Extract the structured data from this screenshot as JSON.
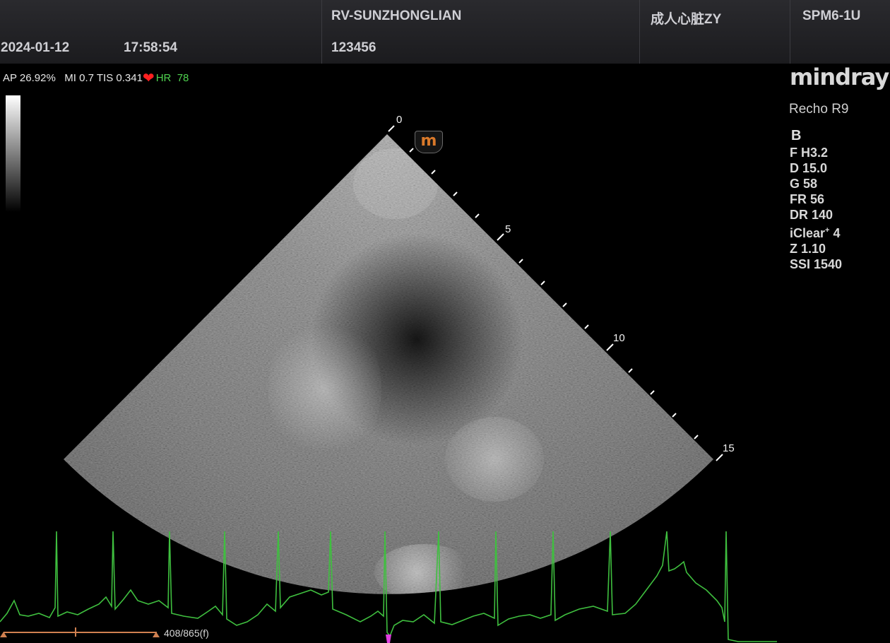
{
  "header": {
    "date": "2024-01-12",
    "time": "17:58:54",
    "patient_name": "RV-SUNZHONGLIAN",
    "patient_id": "123456",
    "exam_preset": "成人心脏ZY",
    "probe": "SPM6-1U"
  },
  "params": {
    "ap": "AP 26.92%",
    "mi_tis": "MI 0.7 TIS 0.341",
    "hr_label": "HR",
    "hr_value": "78"
  },
  "brand": {
    "logo": "mindray",
    "model": "Recho R9"
  },
  "imaging": {
    "mode": "B",
    "freq": "F H3.2",
    "depth": "D 15.0",
    "gain": "G 58",
    "frame_rate": "FR 56",
    "dynamic_range": "DR 140",
    "iclear_label": "iClear",
    "iclear_sup": "+",
    "iclear_value": " 4",
    "zoom": "Z 1.10",
    "ssi": "SSI 1540"
  },
  "depth_scale": {
    "labels": [
      "0",
      "5",
      "10",
      "15"
    ]
  },
  "orientation_marker": "m",
  "cine": {
    "frame_counter": "408/865(f)",
    "progress": 0.4717
  },
  "colors": {
    "ecg": "#3fbf3f",
    "heart": "#ff2020",
    "hr_text": "#4fd24f",
    "marker": "#d9792a",
    "cine_bar": "#d08050",
    "cursor": "#e040e0"
  },
  "icons": [
    "heart-icon",
    "orientation-marker-icon",
    "grayscale-bar"
  ]
}
